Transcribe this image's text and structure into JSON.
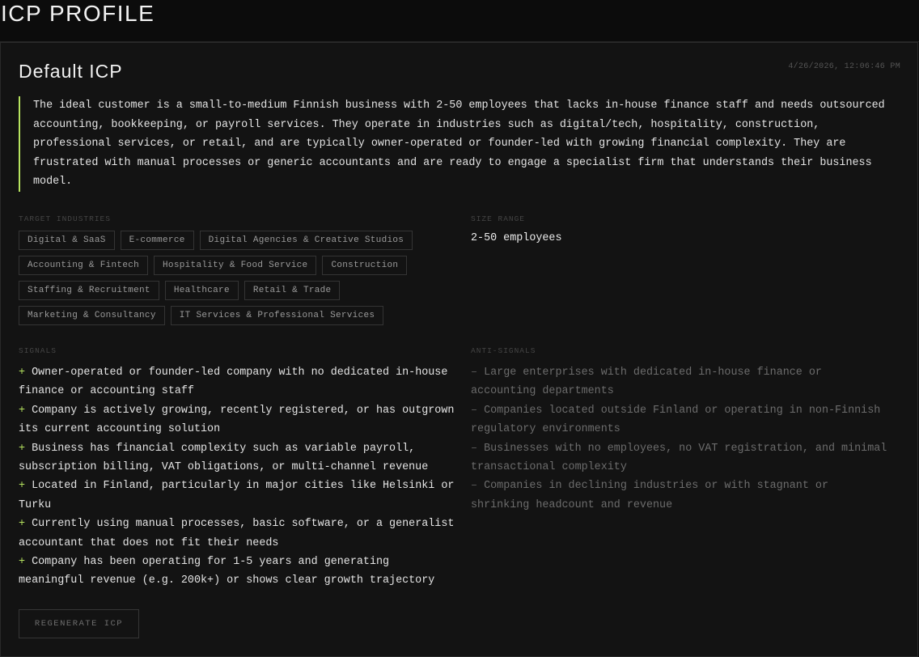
{
  "header": {
    "title": "ICP PROFILE"
  },
  "profile": {
    "name": "Default ICP",
    "timestamp": "4/26/2026, 12:06:46 PM",
    "summary": "The ideal customer is a small-to-medium Finnish business with 2-50 employees that lacks in-house finance staff and needs outsourced accounting, bookkeeping, or payroll services. They operate in industries such as digital/tech, hospitality, construction, professional services, or retail, and are typically owner-operated or founder-led with growing financial complexity. They are frustrated with manual processes or generic accountants and are ready to engage a specialist firm that understands their business model.",
    "target_industries_label": "TARGET INDUSTRIES",
    "target_industries": [
      "Digital & SaaS",
      "E-commerce",
      "Digital Agencies & Creative Studios",
      "Accounting & Fintech",
      "Hospitality & Food Service",
      "Construction",
      "Staffing & Recruitment",
      "Healthcare",
      "Retail & Trade",
      "Marketing & Consultancy",
      "IT Services & Professional Services"
    ],
    "size_range_label": "SIZE RANGE",
    "size_range": "2-50 employees",
    "signals_label": "SIGNALS",
    "signals_marker": "+",
    "signals": [
      "Owner-operated or founder-led company with no dedicated in-house finance or accounting staff",
      "Company is actively growing, recently registered, or has outgrown its current accounting solution",
      "Business has financial complexity such as variable payroll, subscription billing, VAT obligations, or multi-channel revenue",
      "Located in Finland, particularly in major cities like Helsinki or Turku",
      "Currently using manual processes, basic software, or a generalist accountant that does not fit their needs",
      "Company has been operating for 1-5 years and generating meaningful revenue (e.g. 200k+) or shows clear growth trajectory"
    ],
    "anti_signals_label": "ANTI-SIGNALS",
    "anti_signals_marker": "–",
    "anti_signals": [
      "Large enterprises with dedicated in-house finance or accounting departments",
      "Companies located outside Finland or operating in non-Finnish regulatory environments",
      "Businesses with no employees, no VAT registration, and minimal transactional complexity",
      "Companies in declining industries or with stagnant or shrinking headcount and revenue"
    ],
    "regenerate_label": "REGENERATE ICP"
  },
  "colors": {
    "accent": "#b6e35f",
    "background": "#0c0c0c",
    "card": "#131313"
  }
}
